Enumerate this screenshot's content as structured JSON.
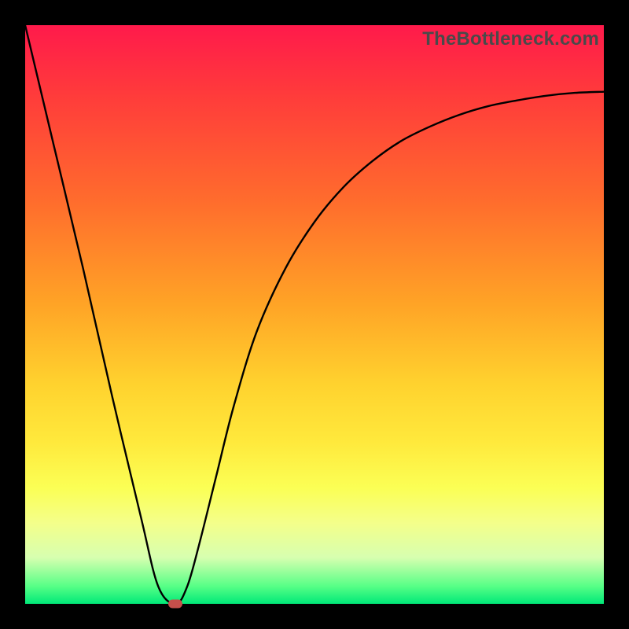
{
  "watermark": "TheBottleneck.com",
  "colors": {
    "frame": "#000000",
    "curve": "#000000",
    "marker": "#c64f4b",
    "gradient_stops": [
      "#ff1a4b",
      "#ff3b3b",
      "#ff6b2d",
      "#ffa326",
      "#ffd22e",
      "#ffe93c",
      "#fbff55",
      "#f4ff8a",
      "#d7ffb0",
      "#56ff86",
      "#00e978"
    ]
  },
  "chart_data": {
    "type": "line",
    "title": "",
    "xlabel": "",
    "ylabel": "",
    "xlim": [
      0,
      100
    ],
    "ylim": [
      0,
      100
    ],
    "series": [
      {
        "name": "bottleneck-curve",
        "x": [
          0,
          5,
          10,
          15,
          20,
          23,
          26,
          28,
          30,
          33,
          36,
          40,
          45,
          50,
          55,
          60,
          65,
          70,
          75,
          80,
          85,
          90,
          95,
          100
        ],
        "values": [
          100,
          79,
          58,
          36,
          15,
          3,
          0,
          3,
          10,
          22,
          34,
          47,
          58,
          66,
          72,
          76.5,
          80,
          82.5,
          84.5,
          86,
          87,
          87.8,
          88.3,
          88.5
        ]
      }
    ],
    "marker": {
      "x": 26,
      "y": 0,
      "label": "optimal-point"
    },
    "grid": false,
    "legend": false
  }
}
